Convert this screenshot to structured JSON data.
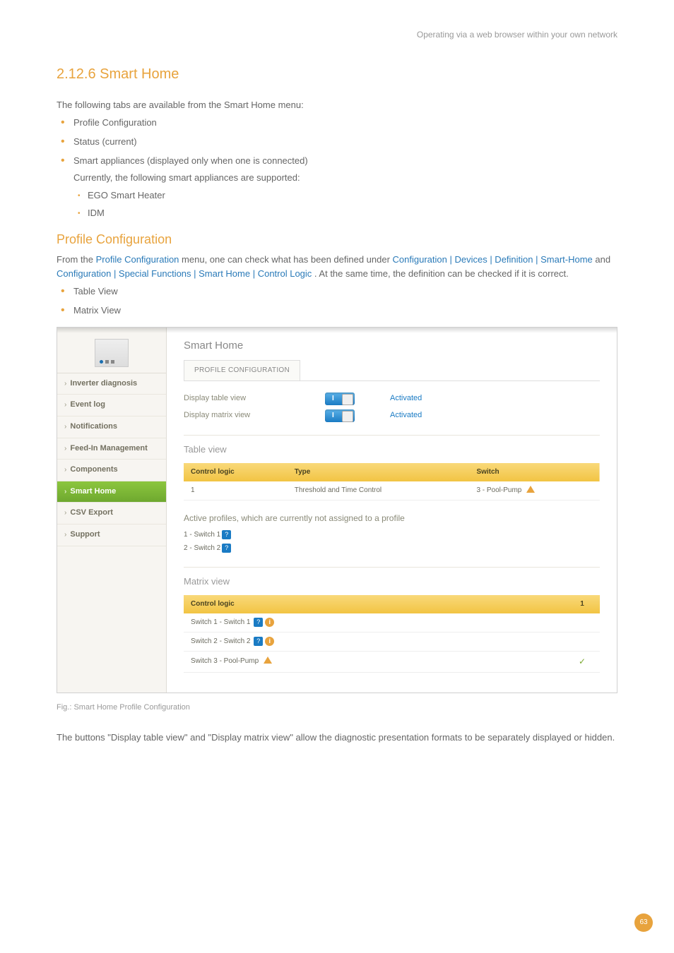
{
  "header": {
    "running_title": "Operating via a web browser within your own network"
  },
  "section": {
    "number_title": "2.12.6 Smart Home",
    "intro": "The following tabs are available from the Smart Home menu:",
    "bullets": {
      "b1": "Profile Configuration",
      "b2": "Status (current)",
      "b3": "Smart appliances (displayed only when one is connected)",
      "b3_sub": "Currently, the following smart appliances are supported:",
      "b3_s1": "EGO Smart Heater",
      "b3_s2": "IDM"
    },
    "profile_heading": "Profile Configuration",
    "profile_p1_a": "From the ",
    "profile_p1_link1": "Profile Configuration",
    "profile_p1_b": " menu, one can check what has been defined under ",
    "profile_p1_link2": "Configuration | Devices | Definition | Smart-Home",
    "profile_p1_c": " and ",
    "profile_p1_link3": "Configuration | Special Functions | Smart Home | Control Logic",
    "profile_p1_d": ". At the same time, the definition can be checked if it is correct.",
    "profile_bullets": {
      "pb1": "Table View",
      "pb2": "Matrix View"
    }
  },
  "ui": {
    "sidebar": {
      "items": [
        {
          "label": "Inverter diagnosis",
          "bold": true
        },
        {
          "label": "Event log",
          "bold": true
        },
        {
          "label": "Notifications",
          "bold": true
        },
        {
          "label": "Feed-In Management",
          "bold": true
        },
        {
          "label": "Components",
          "bold": true
        },
        {
          "label": "Smart Home",
          "bold": true,
          "active": true
        },
        {
          "label": "CSV Export",
          "bold": true
        },
        {
          "label": "Support",
          "bold": true
        }
      ]
    },
    "main": {
      "title": "Smart Home",
      "tab": "PROFILE CONFIGURATION",
      "toggles": {
        "t1_label": "Display table view",
        "t1_status": "Activated",
        "t2_label": "Display matrix view",
        "t2_status": "Activated"
      },
      "table_view": {
        "heading": "Table view",
        "headers": {
          "h1": "Control logic",
          "h2": "Type",
          "h3": "Switch"
        },
        "row1": {
          "c1": "1",
          "c2": "Threshold and Time Control",
          "c3": "3 - Pool-Pump"
        }
      },
      "profiles": {
        "note": "Active profiles, which are currently not assigned to a profile",
        "p1": "1 - Switch 1",
        "p2": "2 - Switch 2"
      },
      "matrix": {
        "heading": "Matrix view",
        "headers": {
          "h1": "Control logic",
          "h2": "1"
        },
        "rows": {
          "r1": "Switch  1 - Switch 1",
          "r2": "Switch  2 - Switch 2",
          "r3": "Switch  3 - Pool-Pump"
        }
      }
    }
  },
  "caption": "Fig.: Smart Home Profile Configuration",
  "closing": "The buttons \"Display table view\" and \"Display matrix view\" allow the diagnostic presentation formats to be separately displayed or hidden.",
  "page_number": "63"
}
